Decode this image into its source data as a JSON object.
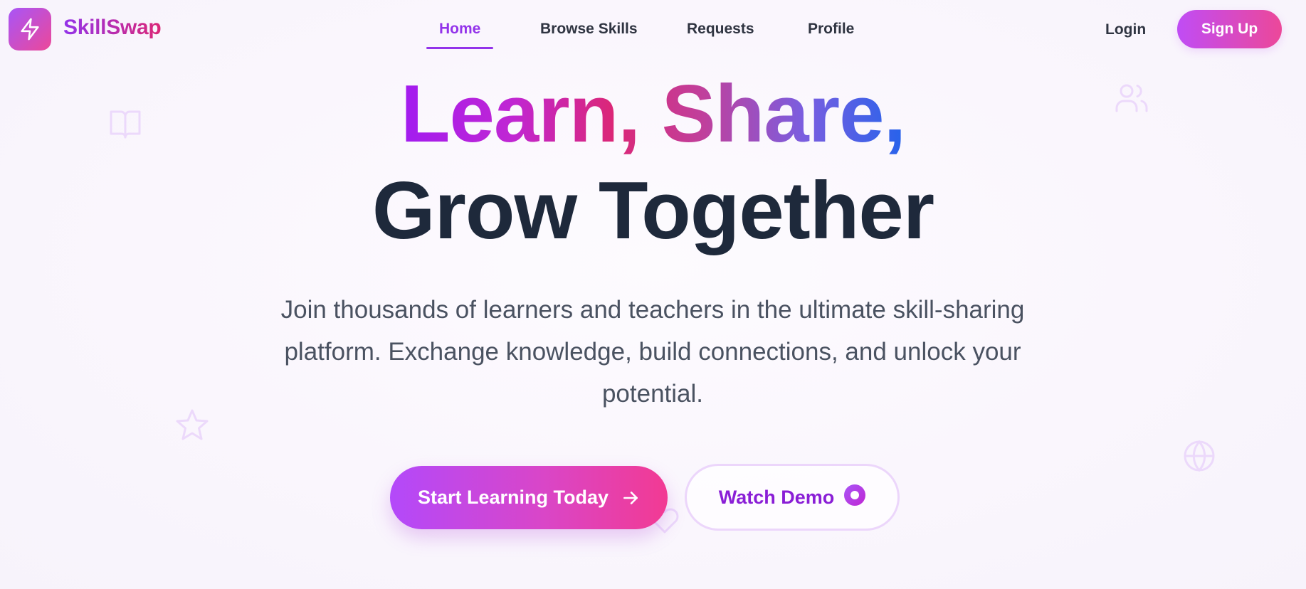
{
  "brand": {
    "name": "SkillSwap",
    "logo_icon": "lightning-bolt-icon"
  },
  "nav": {
    "links": [
      {
        "label": "Home",
        "active": true
      },
      {
        "label": "Browse Skills",
        "active": false
      },
      {
        "label": "Requests",
        "active": false
      },
      {
        "label": "Profile",
        "active": false
      }
    ],
    "login_label": "Login",
    "signup_label": "Sign Up"
  },
  "hero": {
    "line1": "Learn, Share,",
    "line2": "Grow Together",
    "subtitle": "Join thousands of learners and teachers in the ultimate skill-sharing platform. Exchange knowledge, build connections, and unlock your potential.",
    "primary_button": "Start Learning Today",
    "secondary_button": "Watch Demo"
  },
  "decorative_icons": [
    "book-icon",
    "users-icon",
    "star-icon",
    "globe-icon",
    "heart-icon"
  ],
  "colors": {
    "accent_purple": "#9333ea",
    "accent_pink": "#ec4899",
    "heading_dark": "#1e293b",
    "body_text": "#4a5261"
  }
}
